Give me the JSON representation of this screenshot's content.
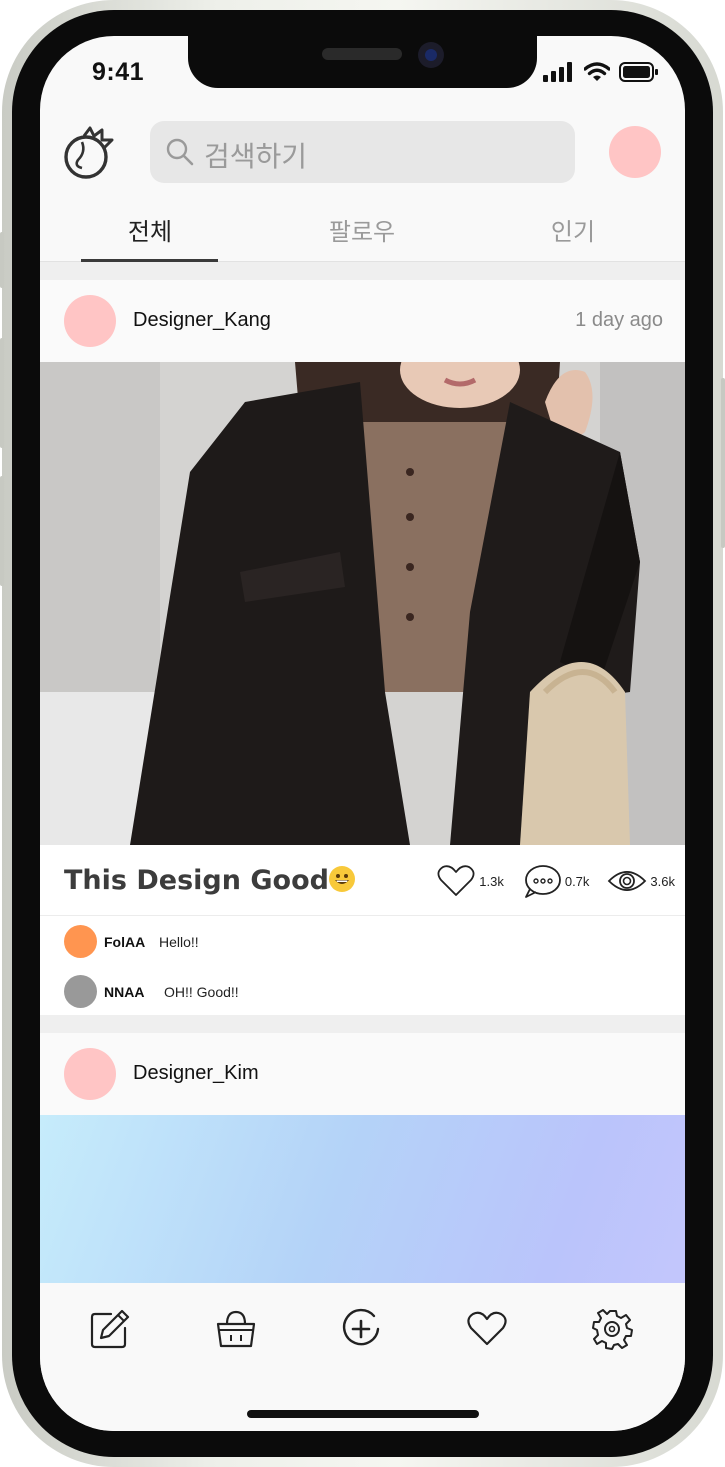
{
  "status_bar": {
    "time": "9:41"
  },
  "header": {
    "search_placeholder": "검색하기"
  },
  "tabs": [
    {
      "label": "전체",
      "active": true
    },
    {
      "label": "팔로우",
      "active": false
    },
    {
      "label": "인기",
      "active": false
    }
  ],
  "posts": [
    {
      "username": "Designer_Kang",
      "time_ago": "1 day ago",
      "title": "This Design Good",
      "stats": {
        "likes": "1.3k",
        "comments": "0.7k",
        "views": "3.6k"
      },
      "comments": [
        {
          "name": "FolAA",
          "text": "Hello!!",
          "avatar_color": "#ff9550"
        },
        {
          "name": "NNAA",
          "text": "OH!! Good!!",
          "avatar_color": "#999999"
        }
      ]
    },
    {
      "username": "Designer_Kim"
    }
  ],
  "bottom_nav": [
    "pencil-icon",
    "shopping-basket-icon",
    "add-circle-icon",
    "heart-icon",
    "settings-icon"
  ],
  "colors": {
    "avatar_pink": "#ffc5c5",
    "accent_dark": "#3a3a3a"
  }
}
